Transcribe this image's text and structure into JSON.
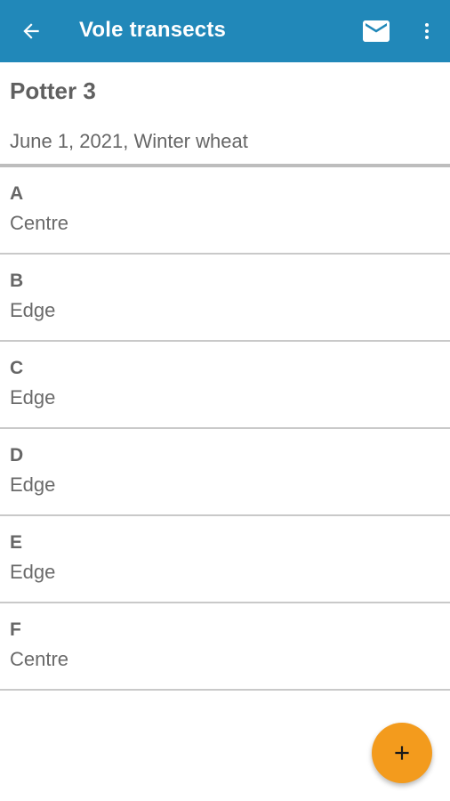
{
  "app_bar": {
    "title": "Vole transects",
    "back_icon": "arrow-left-icon",
    "mail_icon": "mail-icon",
    "more_icon": "more-vertical-icon",
    "color": "#2188b9"
  },
  "site": {
    "name": "Potter 3",
    "subtitle": "June 1, 2021, Winter wheat"
  },
  "transects": [
    {
      "letter": "A",
      "location": "Centre"
    },
    {
      "letter": "B",
      "location": "Edge"
    },
    {
      "letter": "C",
      "location": "Edge"
    },
    {
      "letter": "D",
      "location": "Edge"
    },
    {
      "letter": "E",
      "location": "Edge"
    },
    {
      "letter": "F",
      "location": "Centre"
    }
  ],
  "fab": {
    "icon": "plus-icon",
    "color": "#f39b1d"
  }
}
